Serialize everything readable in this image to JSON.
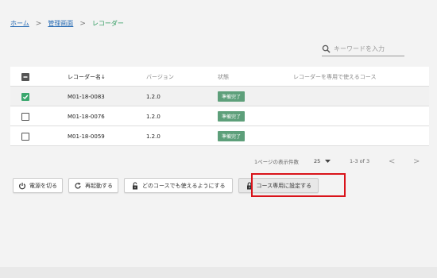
{
  "breadcrumb": {
    "home": "ホーム",
    "admin": "管理画面",
    "current": "レコーダー",
    "separator": ">"
  },
  "search": {
    "placeholder": "キーワードを入力",
    "icon": "search-icon"
  },
  "table": {
    "columns": {
      "name": "レコーダー名↓",
      "version": "バージョン",
      "state": "状態",
      "course": "レコーダーを専用で使えるコース"
    },
    "rows": [
      {
        "name": "M01-18-0083",
        "version": "1.2.0",
        "state": "準備完了",
        "checked": true
      },
      {
        "name": "M01-18-0076",
        "version": "1.2.0",
        "state": "準備完了",
        "checked": false
      },
      {
        "name": "M01-18-0059",
        "version": "1.2.0",
        "state": "準備完了",
        "checked": false
      }
    ]
  },
  "pager": {
    "per_page_label": "1ページの表示件数",
    "per_page_value": "25",
    "range": "1-3 of 3",
    "prev": "<",
    "next": ">"
  },
  "actions": {
    "power_off": "電源を切る",
    "restart": "再起動する",
    "unlock_all": "どのコースでも使えるようにする",
    "set_dedicated": "コース専用に設定する"
  },
  "colors": {
    "accent_green": "#3aa76d",
    "badge_green": "#5d9f7a",
    "highlight_red": "#d9131a",
    "link_blue": "#2a6db5"
  }
}
